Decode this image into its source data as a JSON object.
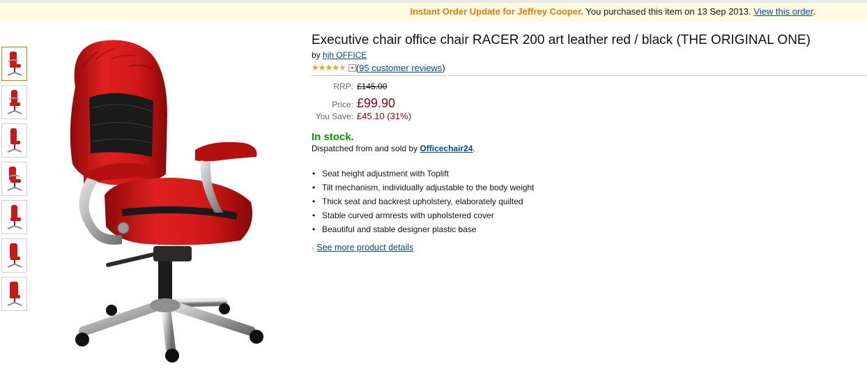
{
  "order_bar": {
    "highlight": "Instant Order Update for Jeffrey Cooper.",
    "message": " You purchased this item on 13 Sep 2013. ",
    "link": "View this order",
    "end": "."
  },
  "thumbnails": [
    {
      "icon": "chair-thumbnail-1"
    },
    {
      "icon": "chair-thumbnail-2"
    },
    {
      "icon": "chair-thumbnail-3"
    },
    {
      "icon": "chair-thumbnail-4"
    },
    {
      "icon": "chair-thumbnail-5"
    },
    {
      "icon": "chair-thumbnail-6"
    },
    {
      "icon": "chair-thumbnail-7"
    }
  ],
  "product": {
    "title": "Executive chair office chair RACER 200 art leather red / black (THE ORIGINAL ONE)",
    "by_prefix": "by ",
    "brand": "hjh OFFICE",
    "rating_stars": 4.5,
    "reviews_prefix": " (",
    "reviews_link": "95 customer reviews",
    "reviews_suffix": ")"
  },
  "pricing": {
    "rrp_label": "RRP:",
    "rrp_value": "£145.00",
    "price_label": "Price:",
    "price_value": "£99.90",
    "save_label": "You Save:",
    "save_value": "£45.10 (31%)"
  },
  "availability": {
    "stock": "In stock.",
    "dispatch_prefix": "Dispatched from and sold by ",
    "seller": "Officechair24",
    "dispatch_suffix": "."
  },
  "features": [
    "Seat height adjustment with Toplift",
    "Tilt mechanism, individually adjustable to the body weight",
    "Thick seat and backrest upholstery, elaborately quilted",
    "Stable curved armrests with upholstered cover",
    "Beautiful and stable designer plastic base"
  ],
  "more_link": "See more product details",
  "colors": {
    "accent_orange": "#e47911",
    "link_blue": "#004b91",
    "price_red": "#990000",
    "stock_green": "#009900",
    "chair_red": "#d01818"
  }
}
